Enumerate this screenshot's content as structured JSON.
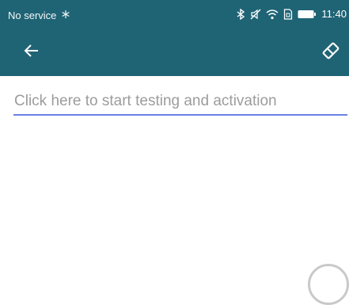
{
  "status_bar": {
    "carrier_text": "No service",
    "time": "11:40",
    "icons": [
      "bluetooth-icon",
      "mute-icon",
      "wifi-icon",
      "sim-icon",
      "battery-icon"
    ]
  },
  "toolbar": {
    "background": "#1f6475",
    "back_icon": "arrow-left-icon",
    "clear_icon": "eraser-icon"
  },
  "main": {
    "activation_placeholder": "Click here to start testing and activation",
    "activation_value": "",
    "underline_color": "#6b7fe3"
  }
}
